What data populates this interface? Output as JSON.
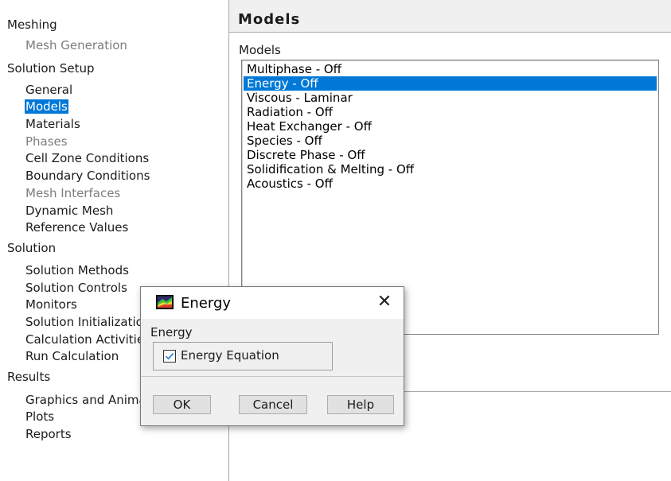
{
  "nav": {
    "groups": [
      {
        "label": "Meshing"
      },
      {
        "label": "Solution Setup"
      },
      {
        "label": "Solution"
      },
      {
        "label": "Results"
      }
    ],
    "items": [
      {
        "label": "Mesh Generation",
        "state": "disabled"
      },
      {
        "label": "General",
        "state": "normal"
      },
      {
        "label": "Models",
        "state": "selected"
      },
      {
        "label": "Materials",
        "state": "normal"
      },
      {
        "label": "Phases",
        "state": "disabled"
      },
      {
        "label": "Cell Zone Conditions",
        "state": "normal"
      },
      {
        "label": "Boundary Conditions",
        "state": "normal"
      },
      {
        "label": "Mesh Interfaces",
        "state": "disabled"
      },
      {
        "label": "Dynamic Mesh",
        "state": "normal"
      },
      {
        "label": "Reference Values",
        "state": "normal"
      },
      {
        "label": "Solution Methods",
        "state": "normal"
      },
      {
        "label": "Solution Controls",
        "state": "normal"
      },
      {
        "label": "Monitors",
        "state": "normal"
      },
      {
        "label": "Solution Initialization",
        "state": "normal"
      },
      {
        "label": "Calculation Activities",
        "state": "normal"
      },
      {
        "label": "Run Calculation",
        "state": "normal"
      },
      {
        "label": "Graphics and Animations",
        "state": "normal"
      },
      {
        "label": "Plots",
        "state": "normal"
      },
      {
        "label": "Reports",
        "state": "normal"
      }
    ]
  },
  "panel": {
    "title": "Models",
    "list_label": "Models",
    "models": [
      {
        "label": "Multiphase - Off",
        "selected": false
      },
      {
        "label": "Energy - Off",
        "selected": true
      },
      {
        "label": "Viscous - Laminar",
        "selected": false
      },
      {
        "label": "Radiation - Off",
        "selected": false
      },
      {
        "label": "Heat Exchanger - Off",
        "selected": false
      },
      {
        "label": "Species - Off",
        "selected": false
      },
      {
        "label": "Discrete Phase - Off",
        "selected": false
      },
      {
        "label": "Solidification & Melting - Off",
        "selected": false
      },
      {
        "label": "Acoustics - Off",
        "selected": false
      }
    ]
  },
  "dialog": {
    "title": "Energy",
    "close_glyph": "✕",
    "group_label": "Energy",
    "checkbox": {
      "label": "Energy Equation",
      "checked": true
    },
    "buttons": {
      "ok": "OK",
      "cancel": "Cancel",
      "help": "Help"
    }
  },
  "colors": {
    "selection": "#0078d7",
    "checkmark": "#1e7bd6",
    "disabled_text": "#7d7d7d"
  }
}
